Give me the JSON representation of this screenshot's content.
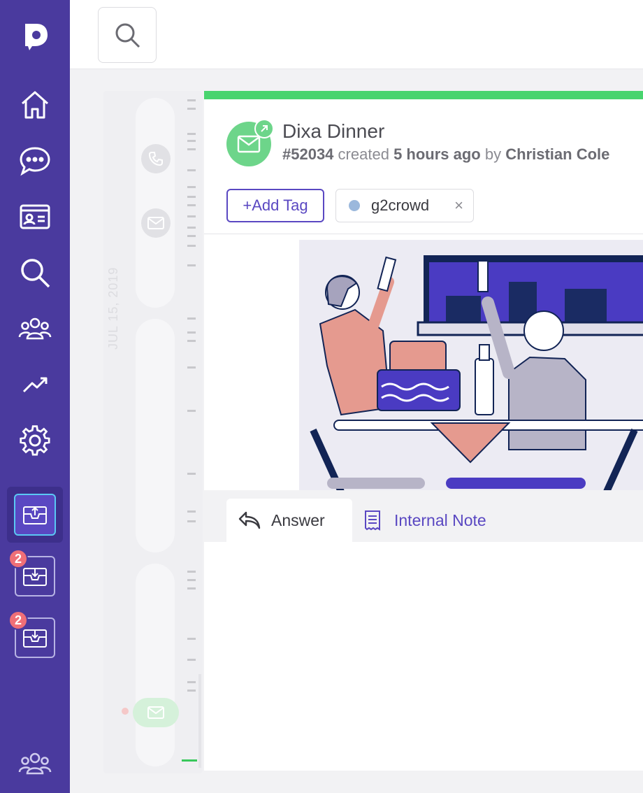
{
  "sidebar": {
    "logo_icon": "dixa-logo-icon",
    "nav": [
      {
        "name": "home",
        "icon": "home-icon"
      },
      {
        "name": "conversations",
        "icon": "chat-bubble-icon"
      },
      {
        "name": "contacts",
        "icon": "id-card-icon"
      },
      {
        "name": "search",
        "icon": "search-icon"
      },
      {
        "name": "teams",
        "icon": "users-icon"
      },
      {
        "name": "analytics",
        "icon": "trend-icon"
      },
      {
        "name": "settings",
        "icon": "gear-icon"
      }
    ],
    "inboxes": [
      {
        "name": "outbox",
        "icon": "mail-upload-icon",
        "active": true
      },
      {
        "name": "inbox-1",
        "icon": "mail-download-icon",
        "badge": "2"
      },
      {
        "name": "inbox-2",
        "icon": "mail-download-icon",
        "badge": "2"
      }
    ],
    "bottom_icon": "users-icon"
  },
  "topbar": {
    "search_icon": "search-icon"
  },
  "timeline": {
    "date_label": "JUL 15, 2019",
    "icons": [
      "phone-icon",
      "mail-icon",
      "mail-icon"
    ]
  },
  "conversation": {
    "title": "Dixa Dinner",
    "id": "#52034",
    "created_word": "created",
    "time": "5 hours ago",
    "by_word": "by",
    "author": "Christian Cole",
    "add_tag_label": "+Add Tag",
    "tags": [
      {
        "label": "g2crowd",
        "color": "#9bb8dc"
      }
    ],
    "tag_remove_glyph": "×"
  },
  "reply": {
    "answer_label": "Answer",
    "internal_note_label": "Internal Note"
  },
  "colors": {
    "sidebar": "#4a3a9e",
    "accent": "#5a48c2",
    "green": "#48d46e",
    "badge": "#ef6f77"
  }
}
